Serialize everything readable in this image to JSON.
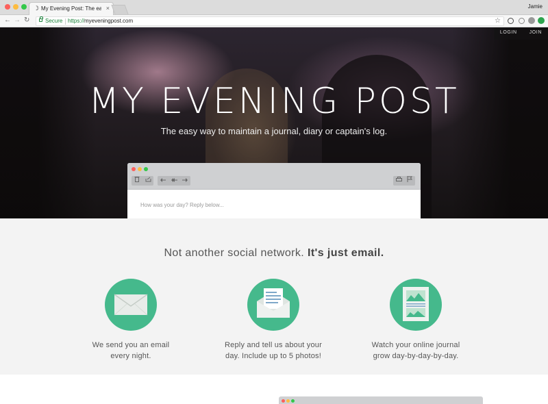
{
  "browser": {
    "tab_title": "My Evening Post: The easy wa",
    "tab_close": "×",
    "favicon": "☽",
    "profile_name": "Jamie",
    "secure_label": "Secure",
    "url_scheme": "https://",
    "url_host": "myeveningpost.com",
    "back": "←",
    "forward": "→",
    "reload": "↻",
    "star": "☆"
  },
  "hero": {
    "nav": {
      "login": "LOGIN",
      "join": "JOIN"
    },
    "title": "MY EVENING POST",
    "subtitle": "The easy way to maintain a journal, diary or captain's log.",
    "mail_prompt": "How was your day? Reply below...",
    "icons": [
      "trash-icon",
      "move-icon",
      "reply-icon",
      "reply-all-icon",
      "forward-icon",
      "print-icon",
      "flag-icon"
    ]
  },
  "features": {
    "tagline_normal": "Not another social network.",
    "tagline_bold": "It's just email.",
    "items": [
      {
        "icon": "envelope-icon",
        "line1": "We send you an email",
        "line2": "every night."
      },
      {
        "icon": "open-letter-icon",
        "line1": "Reply and tell us about your",
        "line2": "day. Include up to 5 photos!"
      },
      {
        "icon": "journal-page-icon",
        "line1": "Watch your online journal",
        "line2": "grow day-by-day-by-day."
      }
    ]
  },
  "colors": {
    "accent_green": "#45b98c",
    "traffic_red": "#fc605c",
    "traffic_yellow": "#fdbc40",
    "traffic_green": "#34c84a",
    "secure_green": "#188038"
  }
}
